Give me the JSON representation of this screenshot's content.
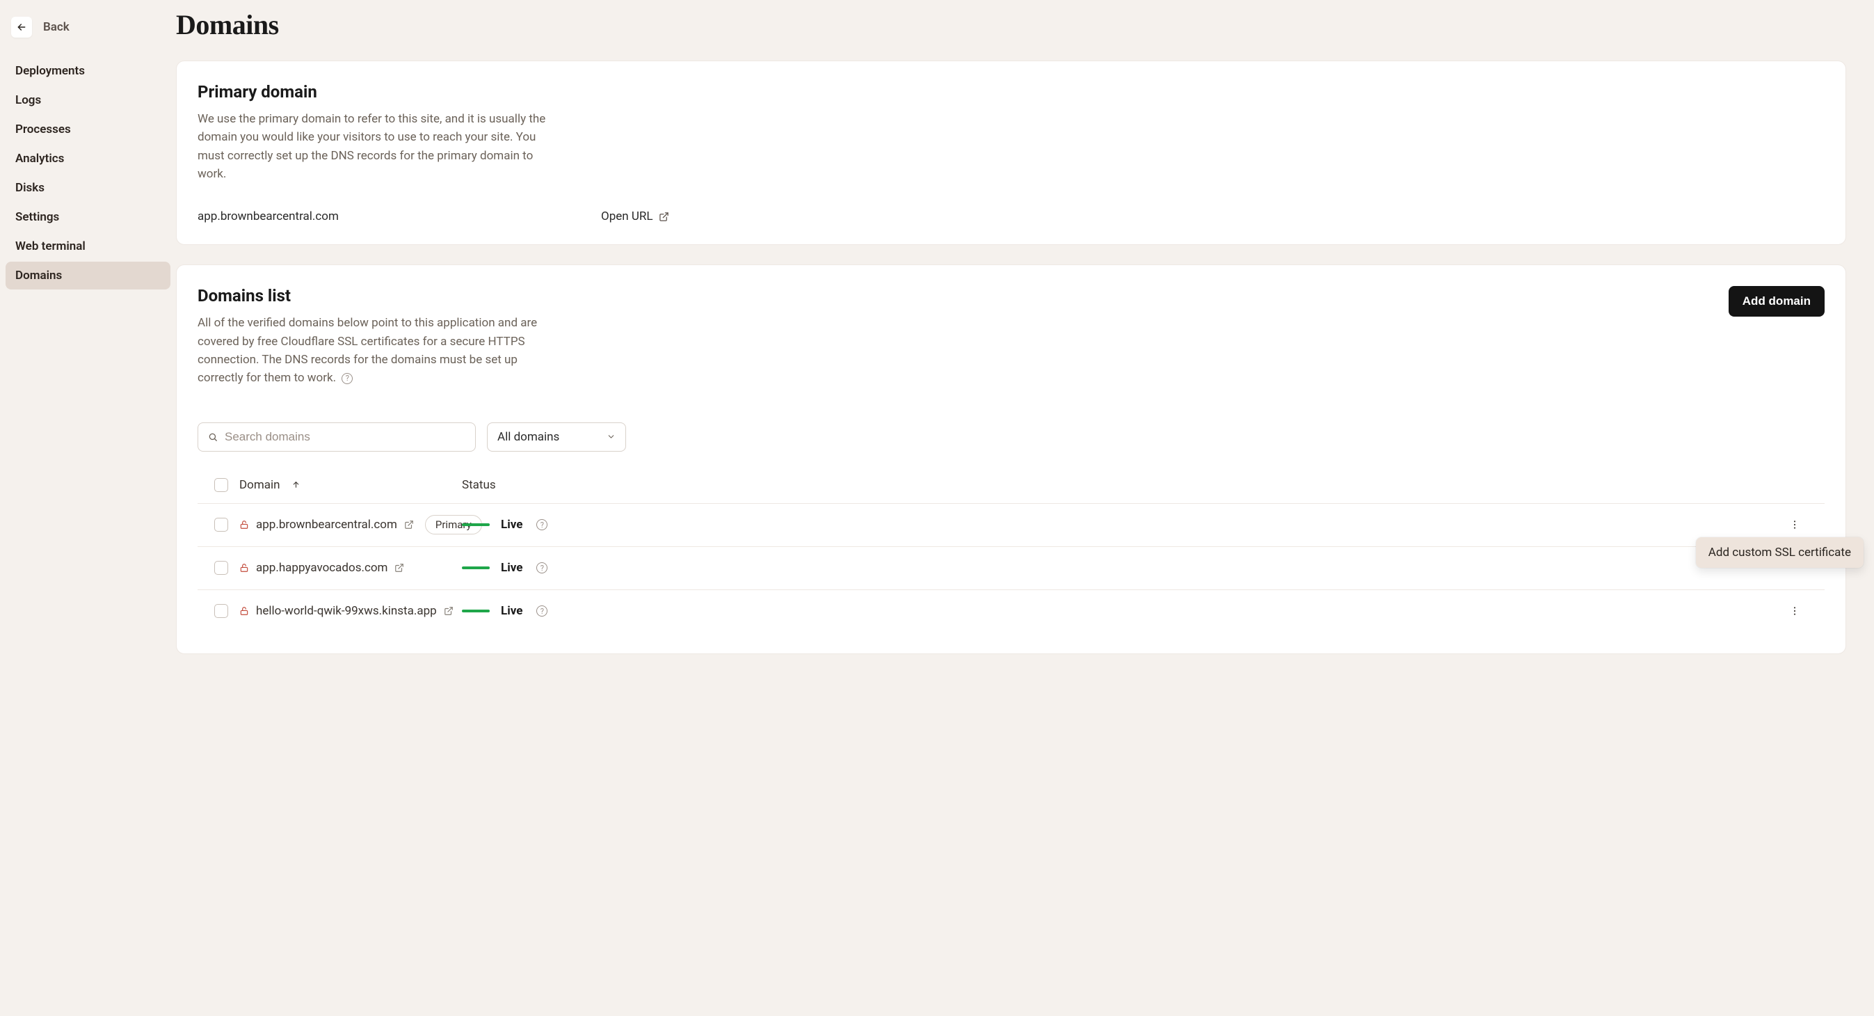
{
  "back": {
    "label": "Back"
  },
  "sidebar": {
    "items": [
      {
        "label": "Deployments"
      },
      {
        "label": "Logs"
      },
      {
        "label": "Processes"
      },
      {
        "label": "Analytics"
      },
      {
        "label": "Disks"
      },
      {
        "label": "Settings"
      },
      {
        "label": "Web terminal"
      },
      {
        "label": "Domains"
      }
    ],
    "active_index": 7
  },
  "page": {
    "title": "Domains"
  },
  "primary": {
    "heading": "Primary domain",
    "description": "We use the primary domain to refer to this site, and it is usually the domain you would like your visitors to use to reach your site. You must correctly set up the DNS records for the primary domain to work.",
    "domain": "app.brownbearcentral.com",
    "open_url_label": "Open URL"
  },
  "list": {
    "heading": "Domains list",
    "description": "All of the verified domains below point to this application and are covered by free Cloudflare SSL certificates for a secure HTTPS connection. The DNS records for the domains must be set up correctly for them to work.",
    "add_button": "Add domain",
    "search_placeholder": "Search domains",
    "filter_value": "All domains",
    "columns": {
      "domain": "Domain",
      "status": "Status"
    },
    "primary_badge": "Primary",
    "rows": [
      {
        "domain": "app.brownbearcentral.com",
        "status": "Live",
        "is_primary": true,
        "show_kebab": true
      },
      {
        "domain": "app.happyavocados.com",
        "status": "Live",
        "is_primary": false,
        "show_kebab": false
      },
      {
        "domain": "hello-world-qwik-99xws.kinsta.app",
        "status": "Live",
        "is_primary": false,
        "show_kebab": true
      }
    ],
    "popover": {
      "label": "Add custom SSL certificate"
    }
  }
}
